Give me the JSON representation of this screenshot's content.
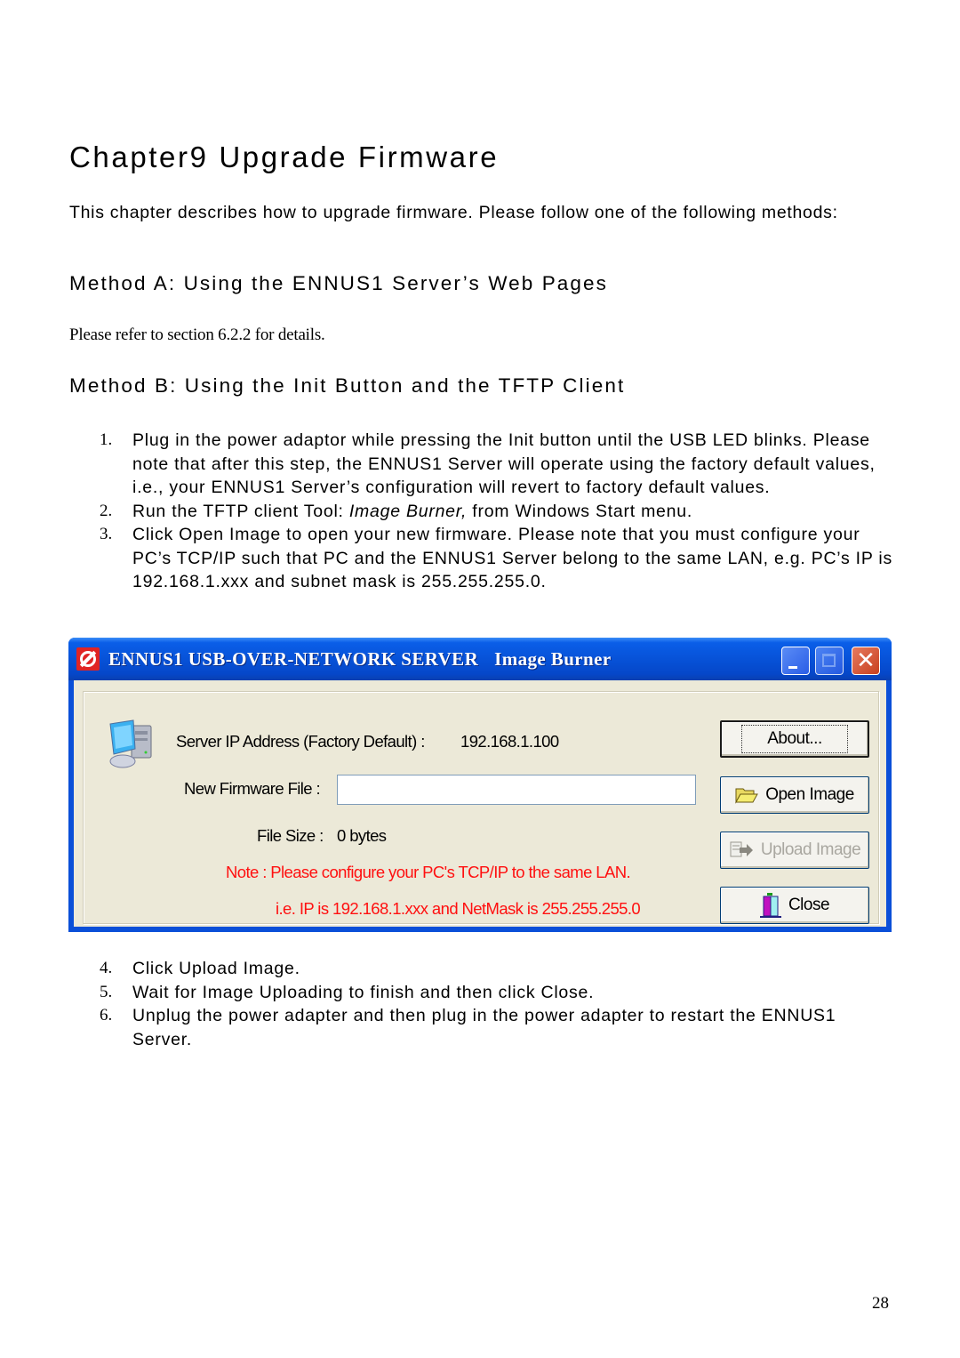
{
  "chapter": {
    "title": "Chapter9   Upgrade Firmware",
    "intro": "This chapter describes how to upgrade firmware. Please follow one of the following methods:"
  },
  "method_a": {
    "heading": "Method A: Using the ENNUS1 Server’s Web Pages",
    "body": "Please refer to section 6.2.2 for details."
  },
  "method_b": {
    "heading": "Method B: Using the Init Button and the TFTP Client",
    "steps_before": [
      {
        "num": "1.",
        "text": "Plug in the power adaptor while pressing the Init button until the USB LED blinks. Please note that after this step, the ENNUS1 Server will operate using the factory default values, i.e., your ENNUS1 Server’s configuration will revert to factory default values."
      },
      {
        "num": "2.",
        "pre": "Run the TFTP client Tool: ",
        "em": "Image Burner,",
        "post": " from Windows Start menu."
      },
      {
        "num": "3.",
        "text": "Click Open Image to open your new firmware. Please note that you must configure your PC’s TCP/IP such that PC and the ENNUS1 Server belong to the same LAN, e.g. PC’s IP is 192.168.1.xxx and subnet mask is 255.255.255.0."
      }
    ],
    "steps_after": [
      {
        "num": "4.",
        "text": "Click Upload Image."
      },
      {
        "num": "5.",
        "text": "Wait for Image Uploading to finish and then click Close."
      },
      {
        "num": "6.",
        "text": "Unplug the power adapter and then plug in the power adapter to restart the ENNUS1 Server."
      }
    ]
  },
  "dialog": {
    "title_main": "ENNUS1 USB-OVER-NETWORK  SERVER",
    "title_sub": "Image Burner",
    "close_glyph": "✕",
    "server_ip_label": "Server IP Address (Factory Default)  :",
    "server_ip_value": "192.168.1.100",
    "firmware_label": "New Firmware File :",
    "firmware_value": "",
    "file_size_label": "File Size :",
    "file_size_value": "0 bytes",
    "note_line1": "Note : Please configure your PC's TCP/IP to the same LAN.",
    "note_line2": "i.e. IP is 192.168.1.xxx and NetMask is 255.255.255.0",
    "buttons": {
      "about": "About...",
      "open": "Open Image",
      "upload": "Upload Image",
      "close": "Close"
    },
    "colors": {
      "titlebar": "#0752d8",
      "note": "#ff1010",
      "face": "#ece9d8"
    }
  },
  "page_number": "28"
}
